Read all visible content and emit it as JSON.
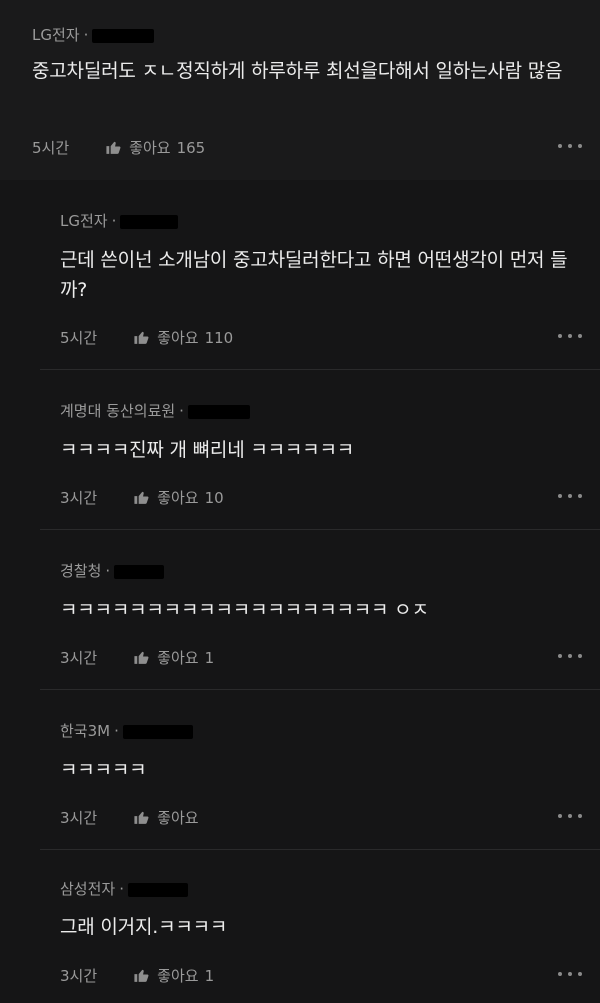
{
  "comments": [
    {
      "company": "LG전자",
      "text": "중고차딜러도 ㅈㄴ정직하게 하루하루 최선을다해서 일하는사람 많음",
      "time": "5시간",
      "like_label": "좋아요",
      "likes": "165"
    },
    {
      "company": "LG전자",
      "text": "근데 쓴이넌 소개남이 중고차딜러한다고 하면 어떤생각이 먼저 들까?",
      "time": "5시간",
      "like_label": "좋아요",
      "likes": "110"
    },
    {
      "company": "계명대 동산의료원",
      "text": "ㅋㅋㅋㅋ진짜 개 뼈리네 ㅋㅋㅋㅋㅋㅋ",
      "time": "3시간",
      "like_label": "좋아요",
      "likes": "10"
    },
    {
      "company": "경찰청",
      "text": "ㅋㅋㅋㅋㅋㅋㅋㅋㅋㅋㅋㅋㅋㅋㅋㅋㅋㅋㅋ ㅇㅈ",
      "time": "3시간",
      "like_label": "좋아요",
      "likes": "1"
    },
    {
      "company": "한국3M",
      "text": "ㅋㅋㅋㅋㅋ",
      "time": "3시간",
      "like_label": "좋아요",
      "likes": ""
    },
    {
      "company": "삼성전자",
      "text": "그래 이거지.ㅋㅋㅋㅋ",
      "time": "3시간",
      "like_label": "좋아요",
      "likes": "1"
    }
  ],
  "separator": "·",
  "icons": {
    "like": "thumbs-up-icon",
    "more": "more-horizontal-icon"
  },
  "colors": {
    "top_background": "#1a1a1b",
    "reply_background": "#151516",
    "meta_text": "#9a9a9a",
    "body_text": "#ececec"
  }
}
